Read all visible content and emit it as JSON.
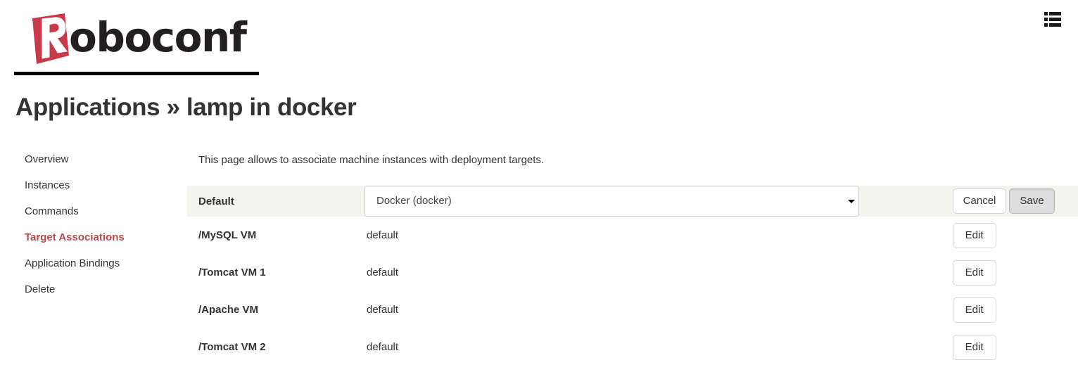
{
  "brand": {
    "mark_letter": "R",
    "word": "oboconf",
    "mark_color": "#c8394a",
    "word_color": "#231f20"
  },
  "header": {
    "menu_icon": "list-icon"
  },
  "page_title": "Applications » lamp in docker",
  "sidebar": {
    "items": [
      {
        "label": "Overview",
        "active": false
      },
      {
        "label": "Instances",
        "active": false
      },
      {
        "label": "Commands",
        "active": false
      },
      {
        "label": "Target Associations",
        "active": true
      },
      {
        "label": "Application Bindings",
        "active": false
      },
      {
        "label": "Delete",
        "active": false
      }
    ],
    "active_color": "#b94a48"
  },
  "main": {
    "intro": "This page allows to associate machine instances with deployment targets.",
    "default_row": {
      "name": "Default",
      "select_value": "Docker (docker)",
      "cancel_label": "Cancel",
      "save_label": "Save",
      "highlight_color": "#f4f4ef"
    },
    "rows": [
      {
        "name": "/MySQL VM",
        "value": "default",
        "edit_label": "Edit"
      },
      {
        "name": "/Tomcat VM 1",
        "value": "default",
        "edit_label": "Edit"
      },
      {
        "name": "/Apache VM",
        "value": "default",
        "edit_label": "Edit"
      },
      {
        "name": "/Tomcat VM 2",
        "value": "default",
        "edit_label": "Edit"
      }
    ]
  }
}
